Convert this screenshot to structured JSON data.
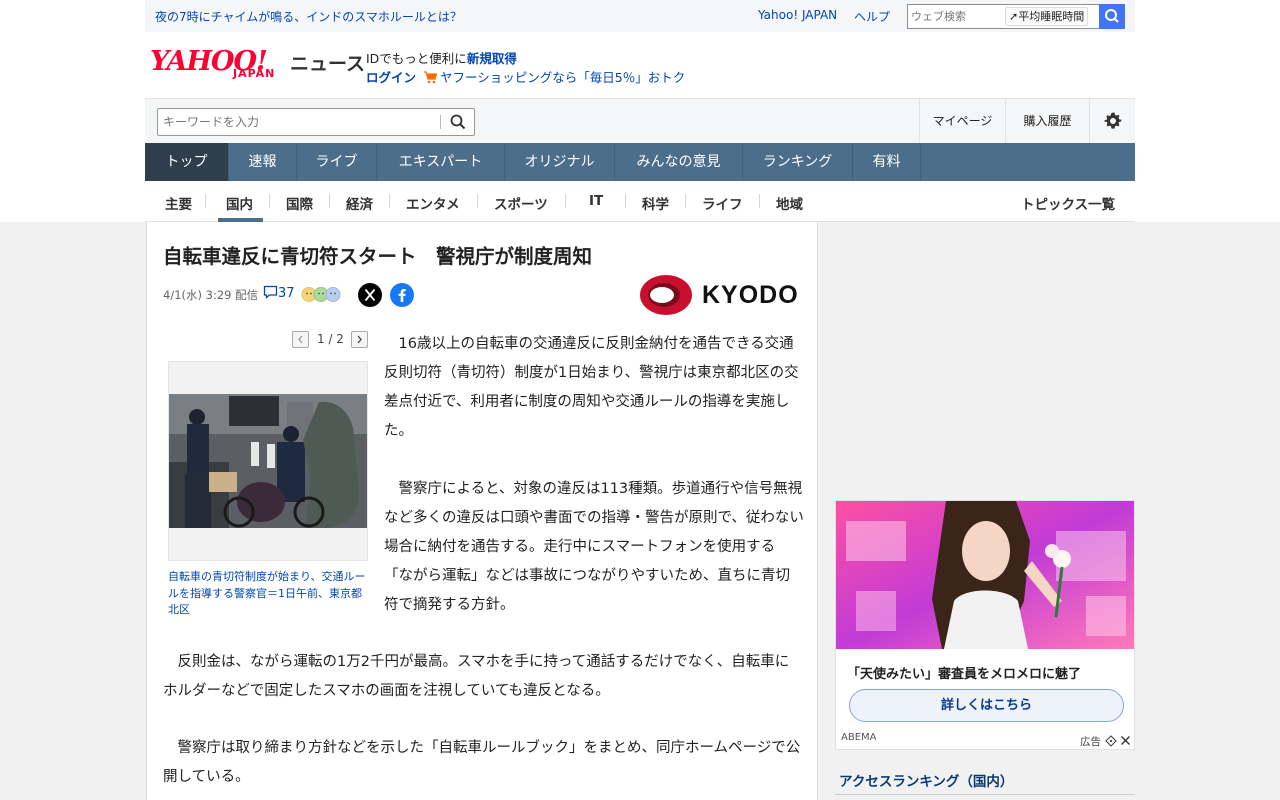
{
  "promo": {
    "headline": "夜の7時にチャイムが鳴る、インドのスマホルールとは？",
    "yahoo_japan": "Yahoo! JAPAN",
    "help": "ヘルプ",
    "web_search_placeholder": "ウェブ検索",
    "search_assist": "平均睡眠時間"
  },
  "header": {
    "logo_main": "YAHOO!",
    "logo_sub": "JAPAN",
    "logo_news": "ニュース",
    "id_text": "IDでもっと便利に",
    "id_link": "新規取得",
    "login": "ログイン",
    "shopping": "ヤフーショッピングなら「毎日5％」おトク"
  },
  "search": {
    "placeholder": "キーワードを入力",
    "mypage": "マイページ",
    "history": "購入履歴"
  },
  "main_nav": [
    {
      "label": "トップ"
    },
    {
      "label": "速報"
    },
    {
      "label": "ライブ"
    },
    {
      "label": "エキスパート"
    },
    {
      "label": "オリジナル"
    },
    {
      "label": "みんなの意見"
    },
    {
      "label": "ランキング"
    },
    {
      "label": "有料"
    }
  ],
  "category_nav": [
    {
      "label": "主要"
    },
    {
      "label": "国内"
    },
    {
      "label": "国際"
    },
    {
      "label": "経済"
    },
    {
      "label": "エンタメ"
    },
    {
      "label": "スポーツ"
    },
    {
      "label": "IT"
    },
    {
      "label": "科学"
    },
    {
      "label": "ライフ"
    },
    {
      "label": "地域"
    }
  ],
  "topics_link": "トピックス一覧",
  "article": {
    "title": "自転車違反に青切符スタート　警視庁が制度周知",
    "date": "4/1(水) 3:29 配信",
    "comment_count": "37",
    "source_logo": "KYODO",
    "pager": "1 / 2",
    "photo_caption": "自転車の青切符制度が始まり、交通ルールを指導する警察官＝1日午前、東京都北区",
    "paragraphs": [
      "　16歳以上の自転車の交通違反に反則金納付を通告できる交通反則切符（青切符）制度が1日始まり、警視庁は東京都北区の交差点付近で、利用者に制度の周知や交通ルールの指導を実施した。",
      "　警察庁によると、対象の違反は113種類。歩道通行や信号無視など多くの違反は口頭や書面での指導・警告が原則で、従わない場合に納付を通告する。走行中にスマートフォンを使用する「ながら運転」などは事故につながりやすいため、直ちに青切符で摘発する方針。",
      "　反則金は、ながら運転の1万2千円が最高。スマホを手に持って通話するだけでなく、自転車にホルダーなどで固定したスマホの画面を注視していても違反となる。",
      "　警察庁は取り締まり方針などを示した「自転車ルールブック」をまとめ、同庁ホームページで公開している。"
    ]
  },
  "ad": {
    "text": "「天使みたい」審査員をメロメロに魅了",
    "button": "詳しくはこちら",
    "source": "ABEMA",
    "label": "広告"
  },
  "ranking_title": "アクセスランキング（国内）"
}
